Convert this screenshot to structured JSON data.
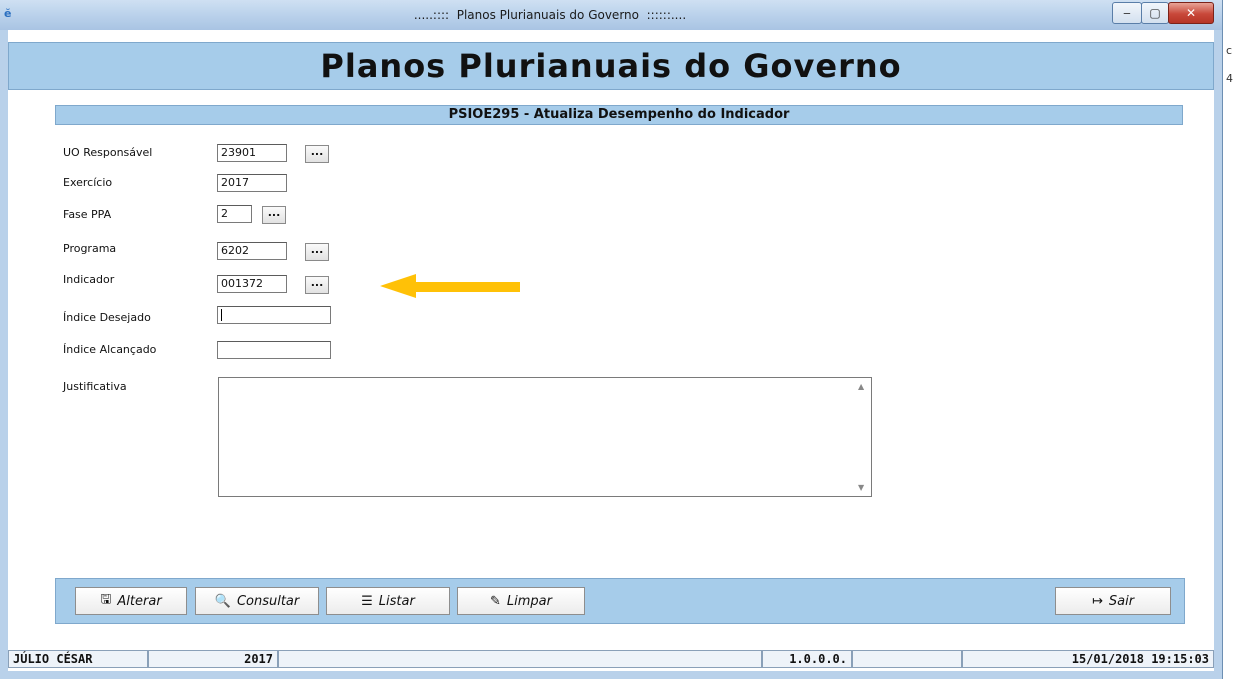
{
  "window": {
    "title": ".....::::  Planos Plurianuais do Governo  ::::::....",
    "icon": "app-icon"
  },
  "header": {
    "title": "Planos Plurianuais do Governo"
  },
  "form": {
    "title": "PSIOE295 - Atualiza Desempenho do Indicador",
    "fields": {
      "uo_label": "UO Responsável",
      "uo_value": "23901",
      "exercicio_label": "Exercício",
      "exercicio_value": "2017",
      "fase_label": "Fase PPA",
      "fase_value": "2",
      "programa_label": "Programa",
      "programa_value": "6202",
      "indicador_label": "Indicador",
      "indicador_value": "001372",
      "desejado_label": "Índice Desejado",
      "desejado_value": "",
      "alcancado_label": "Índice Alcançado",
      "alcancado_value": "",
      "justificativa_label": "Justificativa",
      "justificativa_value": ""
    },
    "lookup_label": "...",
    "annotation_arrow_color": "#ffc107"
  },
  "toolbar": {
    "alterar": "Alterar",
    "consultar": "Consultar",
    "listar": "Listar",
    "limpar": "Limpar",
    "sair": "Sair"
  },
  "status": {
    "user": "JÚLIO CÉSAR",
    "year": "2017",
    "version": "1.0.0.0.",
    "datetime": "15/01/2018 19:15:03"
  },
  "background_text": {
    "a": "c",
    "b": "4"
  }
}
